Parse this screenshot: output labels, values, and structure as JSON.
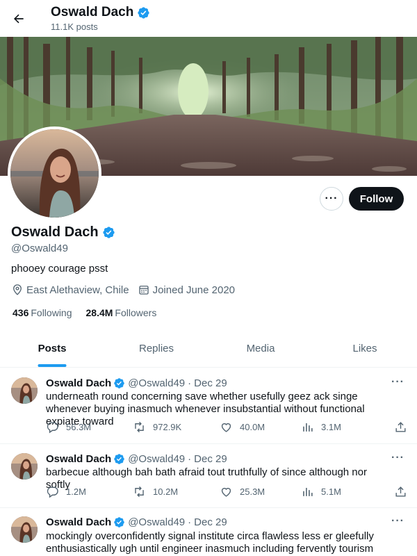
{
  "header": {
    "name": "Oswald Dach",
    "post_count": "11.1K posts"
  },
  "profile": {
    "name": "Oswald Dach",
    "handle": "@Oswald49",
    "bio": "phooey courage psst",
    "location": "East Alethaview, Chile",
    "joined": "Joined June 2020",
    "following_count": "436",
    "following_label": "Following",
    "followers_count": "28.4M",
    "followers_label": "Followers",
    "follow_label": "Follow",
    "more_label": "···"
  },
  "tabs": [
    {
      "label": "Posts",
      "active": true
    },
    {
      "label": "Replies",
      "active": false
    },
    {
      "label": "Media",
      "active": false
    },
    {
      "label": "Likes",
      "active": false
    }
  ],
  "posts": [
    {
      "name": "Oswald Dach",
      "handle": "@Oswald49",
      "separator": "·",
      "date": "Dec 29",
      "menu": "···",
      "text": "underneath round concerning save whether usefully geez ack singe whenever buying inasmuch whenever insubstantial without functional expiate toward",
      "replies": "56.3M",
      "reposts": "972.9K",
      "likes": "40.0M",
      "views": "3.1M"
    },
    {
      "name": "Oswald Dach",
      "handle": "@Oswald49",
      "separator": "·",
      "date": "Dec 29",
      "menu": "···",
      "text": "barbecue although bah bath afraid tout truthfully of since although nor softly",
      "replies": "1.2M",
      "reposts": "10.2M",
      "likes": "25.3M",
      "views": "5.1M"
    },
    {
      "name": "Oswald Dach",
      "handle": "@Oswald49",
      "separator": "·",
      "date": "Dec 29",
      "menu": "···",
      "text": "mockingly overconfidently signal institute circa flawless less er gleefully enthusiastically ugh until engineer inasmuch including fervently tourism"
    }
  ],
  "colors": {
    "accent": "#1d9bf0",
    "text": "#0f1419",
    "secondary": "#536471",
    "follow_bg": "#0f1419"
  }
}
